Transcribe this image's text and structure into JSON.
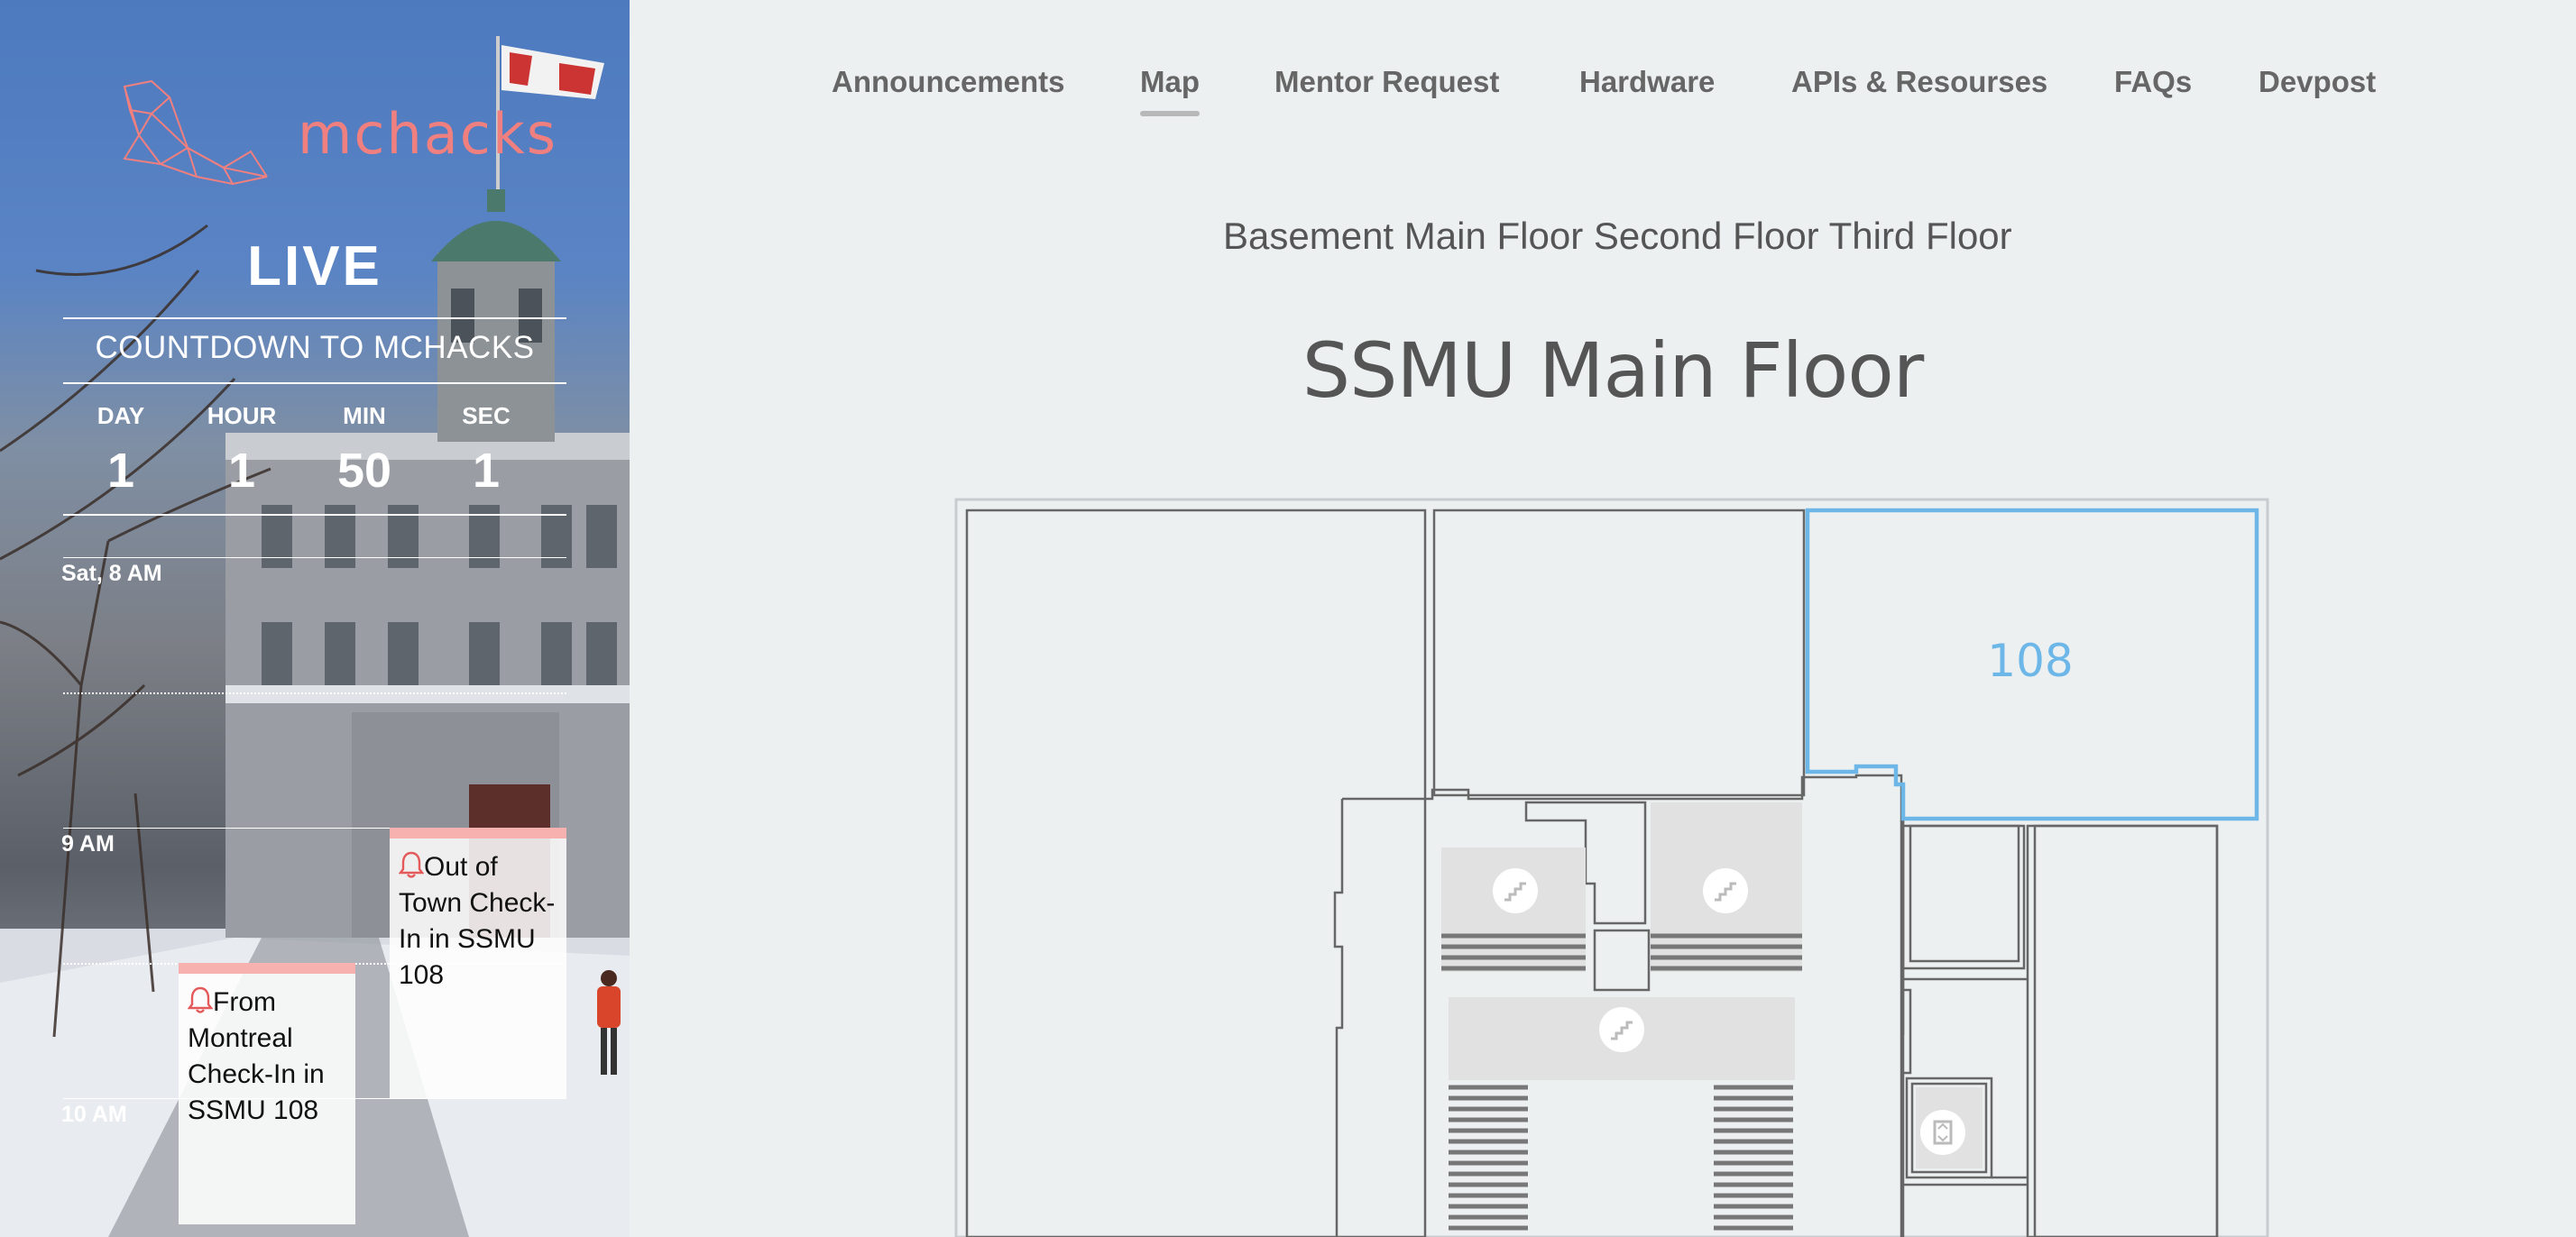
{
  "brand": {
    "name": "mchacks"
  },
  "sidebar": {
    "live_label": "LIVE",
    "countdown_title": "COUNTDOWN TO MCHACKS",
    "countdown": [
      {
        "label": "DAY",
        "value": "1"
      },
      {
        "label": "HOUR",
        "value": "1"
      },
      {
        "label": "MIN",
        "value": "50"
      },
      {
        "label": "SEC",
        "value": "1"
      }
    ],
    "schedule": {
      "times": [
        "Sat, 8 AM",
        "9 AM",
        "10 AM"
      ],
      "events": [
        {
          "title": "Out of Town Check-In in SSMU 108",
          "icon": "bell-icon"
        },
        {
          "title": "From Montreal Check-In in SSMU 108",
          "icon": "bell-icon"
        }
      ]
    }
  },
  "nav": {
    "items": [
      "Announcements",
      "Map",
      "Mentor Request",
      "Hardware",
      "APIs & Resourses",
      "FAQs",
      "Devpost"
    ],
    "active": "Map"
  },
  "floors": [
    "Basement",
    "Main Floor",
    "Second Floor",
    "Third Floor"
  ],
  "map": {
    "title": "SSMU Main Floor",
    "highlighted_room": "108",
    "highlight_color": "#6db7e8",
    "icons": [
      "stairs-icon",
      "stairs-icon",
      "stairs-icon",
      "elevator-icon"
    ]
  },
  "colors": {
    "brand": "#f07f7f",
    "background": "#edf0f1",
    "event_accent": "#f7b2b0"
  }
}
